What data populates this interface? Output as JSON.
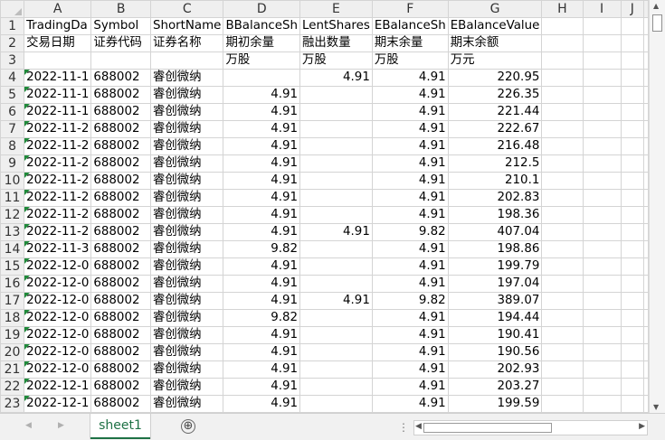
{
  "columns": [
    "A",
    "B",
    "C",
    "D",
    "E",
    "F",
    "G",
    "H",
    "I",
    "J"
  ],
  "header_rows": [
    {
      "row": "1",
      "cells": [
        "TradingDa",
        "Symbol",
        "ShortName",
        "BBalanceSh",
        "LentShares",
        "EBalanceSh",
        "EBalanceValue",
        "",
        "",
        ""
      ]
    },
    {
      "row": "2",
      "cells": [
        "交易日期",
        "证券代码",
        "证券名称",
        "期初余量",
        "融出数量",
        "期末余量",
        "期末余额",
        "",
        "",
        ""
      ]
    },
    {
      "row": "3",
      "cells": [
        "",
        "",
        "",
        "万股",
        "万股",
        "万股",
        "万元",
        "",
        "",
        ""
      ]
    }
  ],
  "data_rows": [
    {
      "row": "4",
      "date": "2022-11-1",
      "symbol": "688002",
      "name": "睿创微纳",
      "bbal": "",
      "lent": "4.91",
      "ebal": "4.91",
      "evalue": "220.95"
    },
    {
      "row": "5",
      "date": "2022-11-1",
      "symbol": "688002",
      "name": "睿创微纳",
      "bbal": "4.91",
      "lent": "",
      "ebal": "4.91",
      "evalue": "226.35"
    },
    {
      "row": "6",
      "date": "2022-11-1",
      "symbol": "688002",
      "name": "睿创微纳",
      "bbal": "4.91",
      "lent": "",
      "ebal": "4.91",
      "evalue": "221.44"
    },
    {
      "row": "7",
      "date": "2022-11-2",
      "symbol": "688002",
      "name": "睿创微纳",
      "bbal": "4.91",
      "lent": "",
      "ebal": "4.91",
      "evalue": "222.67"
    },
    {
      "row": "8",
      "date": "2022-11-2",
      "symbol": "688002",
      "name": "睿创微纳",
      "bbal": "4.91",
      "lent": "",
      "ebal": "4.91",
      "evalue": "216.48"
    },
    {
      "row": "9",
      "date": "2022-11-2",
      "symbol": "688002",
      "name": "睿创微纳",
      "bbal": "4.91",
      "lent": "",
      "ebal": "4.91",
      "evalue": "212.5"
    },
    {
      "row": "10",
      "date": "2022-11-2",
      "symbol": "688002",
      "name": "睿创微纳",
      "bbal": "4.91",
      "lent": "",
      "ebal": "4.91",
      "evalue": "210.1"
    },
    {
      "row": "11",
      "date": "2022-11-2",
      "symbol": "688002",
      "name": "睿创微纳",
      "bbal": "4.91",
      "lent": "",
      "ebal": "4.91",
      "evalue": "202.83"
    },
    {
      "row": "12",
      "date": "2022-11-2",
      "symbol": "688002",
      "name": "睿创微纳",
      "bbal": "4.91",
      "lent": "",
      "ebal": "4.91",
      "evalue": "198.36"
    },
    {
      "row": "13",
      "date": "2022-11-2",
      "symbol": "688002",
      "name": "睿创微纳",
      "bbal": "4.91",
      "lent": "4.91",
      "ebal": "9.82",
      "evalue": "407.04"
    },
    {
      "row": "14",
      "date": "2022-11-3",
      "symbol": "688002",
      "name": "睿创微纳",
      "bbal": "9.82",
      "lent": "",
      "ebal": "4.91",
      "evalue": "198.86"
    },
    {
      "row": "15",
      "date": "2022-12-0",
      "symbol": "688002",
      "name": "睿创微纳",
      "bbal": "4.91",
      "lent": "",
      "ebal": "4.91",
      "evalue": "199.79"
    },
    {
      "row": "16",
      "date": "2022-12-0",
      "symbol": "688002",
      "name": "睿创微纳",
      "bbal": "4.91",
      "lent": "",
      "ebal": "4.91",
      "evalue": "197.04"
    },
    {
      "row": "17",
      "date": "2022-12-0",
      "symbol": "688002",
      "name": "睿创微纳",
      "bbal": "4.91",
      "lent": "4.91",
      "ebal": "9.82",
      "evalue": "389.07"
    },
    {
      "row": "18",
      "date": "2022-12-0",
      "symbol": "688002",
      "name": "睿创微纳",
      "bbal": "9.82",
      "lent": "",
      "ebal": "4.91",
      "evalue": "194.44"
    },
    {
      "row": "19",
      "date": "2022-12-0",
      "symbol": "688002",
      "name": "睿创微纳",
      "bbal": "4.91",
      "lent": "",
      "ebal": "4.91",
      "evalue": "190.41"
    },
    {
      "row": "20",
      "date": "2022-12-0",
      "symbol": "688002",
      "name": "睿创微纳",
      "bbal": "4.91",
      "lent": "",
      "ebal": "4.91",
      "evalue": "190.56"
    },
    {
      "row": "21",
      "date": "2022-12-0",
      "symbol": "688002",
      "name": "睿创微纳",
      "bbal": "4.91",
      "lent": "",
      "ebal": "4.91",
      "evalue": "202.93"
    },
    {
      "row": "22",
      "date": "2022-12-1",
      "symbol": "688002",
      "name": "睿创微纳",
      "bbal": "4.91",
      "lent": "",
      "ebal": "4.91",
      "evalue": "203.27"
    },
    {
      "row": "23",
      "date": "2022-12-1",
      "symbol": "688002",
      "name": "睿创微纳",
      "bbal": "4.91",
      "lent": "",
      "ebal": "4.91",
      "evalue": "199.59"
    }
  ],
  "sheet_tab": "sheet1",
  "add_sheet_icon": "⊕",
  "more_icon": "⋮",
  "nav_prev_icon": "◀",
  "nav_next_icon": "▶",
  "accent_color": "#1e7145",
  "flag_color": "#1f8a3a"
}
